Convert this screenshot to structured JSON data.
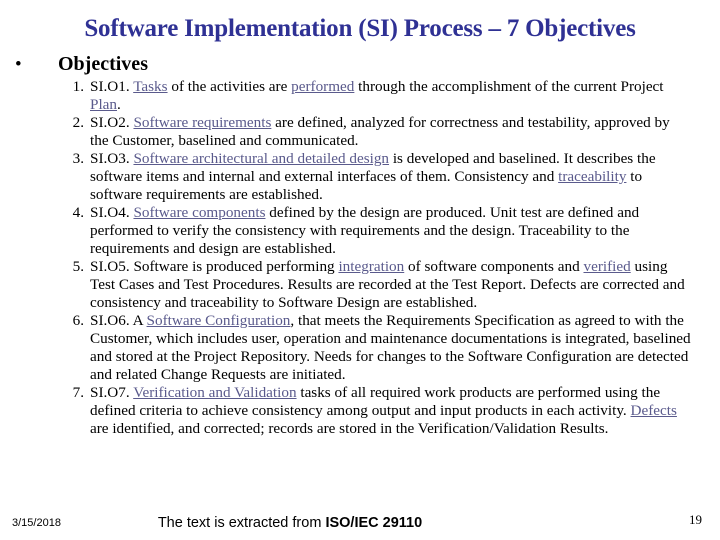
{
  "slide": {
    "title": "Software Implementation (SI) Process – 7 Objectives",
    "title_color": "#2f3194",
    "link_color": "#5a5a8c",
    "background_color": "#ffffff",
    "bullet_glyph": "•",
    "section_heading": "Objectives"
  },
  "objectives": [
    {
      "number": "1.",
      "text": "SI.O1. Tasks of the activities are performed through the accomplishment of the current Project Plan.",
      "parts": [
        {
          "t": "SI.O1. ",
          "link": false
        },
        {
          "t": "Tasks",
          "link": true
        },
        {
          "t": " of the activities are ",
          "link": false
        },
        {
          "t": "performed",
          "link": true
        },
        {
          "t": " through the accomplishment of the current Project ",
          "link": false
        },
        {
          "t": "Plan",
          "link": true
        },
        {
          "t": ".",
          "link": false
        }
      ]
    },
    {
      "number": "2.",
      "text": "SI.O2. Software requirements are defined, analyzed for correctness and testability, approved by the Customer, baselined and communicated.",
      "parts": [
        {
          "t": "SI.O2. ",
          "link": false
        },
        {
          "t": "Software requirements",
          "link": true
        },
        {
          "t": " are defined, analyzed for correctness and testability, approved by the Customer, baselined and communicated.",
          "link": false
        }
      ]
    },
    {
      "number": "3.",
      "text": "SI.O3. Software architectural and detailed design is developed and baselined. It describes the software items and internal and external interfaces of them. Consistency and traceability to software requirements are established.",
      "parts": [
        {
          "t": "SI.O3. ",
          "link": false
        },
        {
          "t": "Software architectural and detailed design",
          "link": true
        },
        {
          "t": " is developed and baselined. It describes the software items and internal and external interfaces of them. Consistency and ",
          "link": false
        },
        {
          "t": "traceability",
          "link": true
        },
        {
          "t": " to software requirements are established.",
          "link": false
        }
      ]
    },
    {
      "number": "4.",
      "text": "SI.O4. Software components defined by the design are produced. Unit test are defined and performed to verify the consistency with requirements and the design. Traceability to the requirements and design are established.",
      "parts": [
        {
          "t": "SI.O4. ",
          "link": false
        },
        {
          "t": "Software components",
          "link": true
        },
        {
          "t": " defined by the design are produced. Unit test are defined and performed to verify the consistency with requirements and the design. Traceability to the requirements and design are established.",
          "link": false
        }
      ]
    },
    {
      "number": "5.",
      "text": "SI.O5. Software is produced performing integration of software components and verified using Test Cases and Test Procedures. Results are recorded at the Test Report. Defects are corrected and consistency and traceability to Software Design are established.",
      "parts": [
        {
          "t": "SI.O5. Software is produced performing ",
          "link": false
        },
        {
          "t": "integration",
          "link": true
        },
        {
          "t": " of software components and ",
          "link": false
        },
        {
          "t": "verified",
          "link": true
        },
        {
          "t": " using Test Cases and Test Procedures. Results are recorded at the Test Report. Defects are corrected and consistency and traceability to Software Design are established.",
          "link": false
        }
      ]
    },
    {
      "number": "6.",
      "text": "SI.O6. A Software Configuration, that meets the Requirements Specification as agreed to with the Customer, which includes user, operation and maintenance documentations is integrated, baselined and stored at the Project Repository. Needs for changes to the Software Configuration are detected and related Change Requests are initiated.",
      "parts": [
        {
          "t": "SI.O6. A ",
          "link": false
        },
        {
          "t": "Software Configuration",
          "link": true
        },
        {
          "t": ", that meets the Requirements Specification as agreed to with the Customer, which includes user, operation and maintenance documentations is integrated, baselined and stored at the Project Repository. Needs for changes to the Software Configuration are detected and related Change Requests are initiated.",
          "link": false
        }
      ]
    },
    {
      "number": "7.",
      "text": "SI.O7. Verification and Validation tasks of all required work products are performed using the defined criteria to achieve consistency among output and input products in each activity. Defects are identified, and corrected; records are stored in the Verification/Validation Results.",
      "parts": [
        {
          "t": "SI.O7. ",
          "link": false
        },
        {
          "t": "Verification and Validation",
          "link": true
        },
        {
          "t": " tasks of all required work products are performed using the defined criteria to achieve consistency among output and input products in each activity. ",
          "link": false
        },
        {
          "t": "Defects",
          "link": true
        },
        {
          "t": " are identified, and corrected; records are stored in the Verification/Validation Results.",
          "link": false
        }
      ]
    }
  ],
  "footer": {
    "date": "3/15/2018",
    "note_prefix": "The text is extracted from ",
    "note_bold": "ISO/IEC 29110",
    "page_number": "19"
  }
}
